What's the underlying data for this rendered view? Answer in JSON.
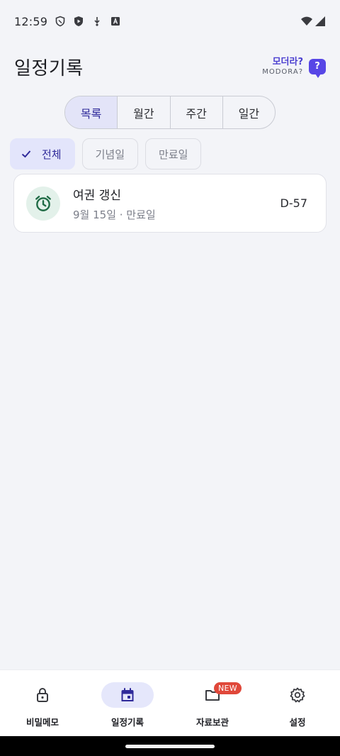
{
  "status_bar": {
    "time": "12:59",
    "icons": [
      "shield-icon",
      "play-shield-icon",
      "download-icon",
      "text-a-icon"
    ],
    "right_icons": [
      "wifi-icon",
      "signal-icon"
    ]
  },
  "header": {
    "title": "일정기록",
    "help_main": "모더라?",
    "help_sub": "MODORA?",
    "help_bubble": "?"
  },
  "view_tabs": [
    {
      "label": "목록",
      "active": true
    },
    {
      "label": "월간",
      "active": false
    },
    {
      "label": "주간",
      "active": false
    },
    {
      "label": "일간",
      "active": false
    }
  ],
  "filters": [
    {
      "label": "전체",
      "active": true
    },
    {
      "label": "기념일",
      "active": false
    },
    {
      "label": "만료일",
      "active": false
    }
  ],
  "schedule_items": [
    {
      "title": "여권 갱신",
      "subtitle": "9월 15일 · 만료일",
      "dday": "D-57",
      "icon": "alarm-clock-icon"
    }
  ],
  "bottom_nav": [
    {
      "label": "비밀메모",
      "icon": "lock-icon",
      "active": false
    },
    {
      "label": "일정기록",
      "icon": "calendar-icon",
      "active": true
    },
    {
      "label": "자료보관",
      "icon": "folder-icon",
      "active": false,
      "badge": "NEW"
    },
    {
      "label": "설정",
      "icon": "gear-icon",
      "active": false
    }
  ],
  "colors": {
    "accent": "#5746e6",
    "accent_text": "#2f2a9a",
    "active_bg": "#e3e4f8",
    "badge": "#e0483a",
    "alarm_icon": "#1f6b45",
    "alarm_bg": "#e3f1ea"
  }
}
